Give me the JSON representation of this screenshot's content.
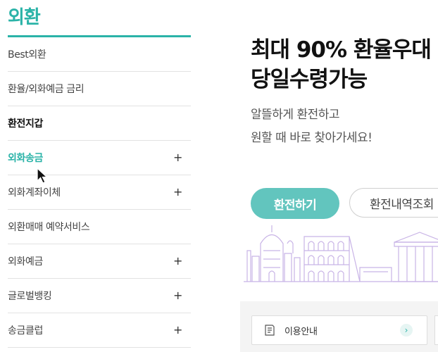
{
  "sidebar": {
    "title": "외환",
    "items": [
      {
        "label": "Best외환",
        "has_plus": false
      },
      {
        "label": "환율/외화예금 금리",
        "has_plus": false
      },
      {
        "label": "환전지갑",
        "has_plus": false
      },
      {
        "label": "외화송금",
        "has_plus": true
      },
      {
        "label": "외화계좌이체",
        "has_plus": true
      },
      {
        "label": "외환매매 예약서비스",
        "has_plus": false
      },
      {
        "label": "외화예금",
        "has_plus": true
      },
      {
        "label": "글로벌뱅킹",
        "has_plus": true
      },
      {
        "label": "송금클럽",
        "has_plus": true
      }
    ],
    "plus_glyph": "+",
    "active_index": 3
  },
  "hero": {
    "title_line1": "최대 90% 환율우대",
    "title_line2": "당일수령가능",
    "sub_line1": "알뜰하게 환전하고",
    "sub_line2": "원할 때 바로 찾아가세요!"
  },
  "buttons": {
    "primary_label": "환전하기",
    "secondary_label": "환전내역조회"
  },
  "info": {
    "label": "이용안내",
    "arrow_glyph": "›"
  },
  "colors": {
    "accent": "#2bb3a8",
    "primary_button": "#62c5be",
    "skyline": "#c8b3e6"
  }
}
